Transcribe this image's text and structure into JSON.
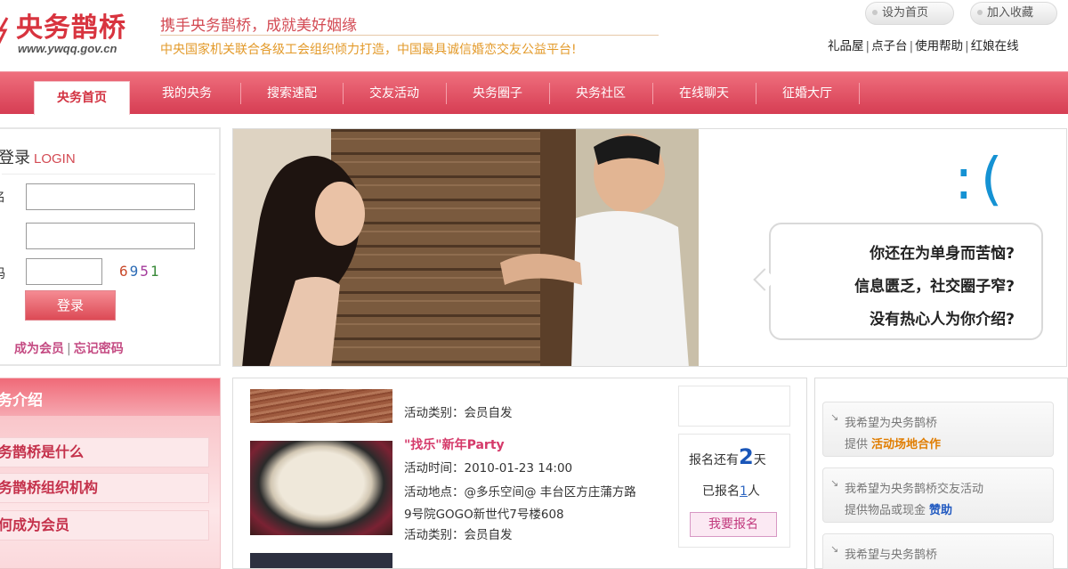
{
  "header": {
    "logo_text": "央务鹊桥",
    "logo_url": "www.ywqq.gov.cn",
    "slogan": "携手央务鹊桥，成就美好姻缘",
    "tagline": "中央国家机关联合各级工会组织倾力打造，中国最具诚信婚恋交友公益平台!",
    "set_home": "设为首页",
    "add_fav": "加入收藏",
    "links": [
      "礼品屋",
      "点子台",
      "使用帮助",
      "红娘在线"
    ]
  },
  "nav": {
    "items": [
      "央务首页",
      "我的央务",
      "搜索速配",
      "交友活动",
      "央务圈子",
      "央务社区",
      "在线聊天",
      "征婚大厅"
    ]
  },
  "login": {
    "title": "登录",
    "title_en": "LOGIN",
    "label_user": "名",
    "label_captcha": "码",
    "user_value": "",
    "password_value": "",
    "captcha_value": "",
    "captcha_code": [
      "6",
      "9",
      "5",
      "1"
    ],
    "button": "登录",
    "link_register": "成为会员",
    "link_forgot": "忘记密码"
  },
  "banner": {
    "emoticon": ":(",
    "lines": [
      "你还在为单身而苦恼?",
      "信息匮乏，社交圈子窄?",
      "没有热心人为你介绍?"
    ]
  },
  "intro": {
    "title": "务介绍",
    "items": [
      "务鹊桥是什么",
      "务鹊桥组织机构",
      "何成为会员"
    ]
  },
  "events": {
    "first_type": "活动类别：会员自发",
    "title": "\"找乐\"新年Party",
    "time": "活动时间：2010-01-23 14:00",
    "place_1": "活动地点：@多乐空间@ 丰台区方庄蒲方路",
    "place_2": "9号院GOGO新世代7号楼608",
    "type": "活动类别：会员自发",
    "days_pre": "报名还有",
    "days_num": "2",
    "days_post": "天",
    "signed_pre": "已报名",
    "signed_count": "1",
    "signed_post": "人",
    "signup_button": "我要报名"
  },
  "side": {
    "cards": [
      {
        "line1": "我希望为央务鹊桥",
        "line2": "提供",
        "highlight": "活动场地合作",
        "color": "#e07d00"
      },
      {
        "line1": "我希望为央务鹊桥交友活动",
        "line2": "提供物品或现金",
        "highlight": "赞助",
        "color": "#1f58c0"
      },
      {
        "line1": "我希望与央务鹊桥",
        "line2": "",
        "highlight": "",
        "color": "#e07d00"
      }
    ]
  }
}
